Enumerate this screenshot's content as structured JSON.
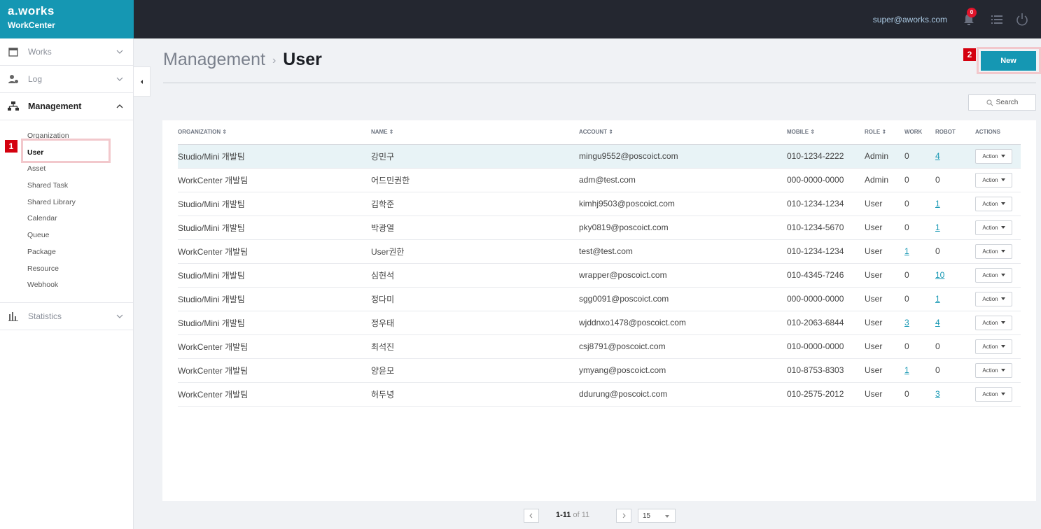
{
  "brand": {
    "logo": "a.works",
    "sub": "WorkCenter"
  },
  "header": {
    "user_email": "super@aworks.com",
    "notification_count": "0"
  },
  "sidebar": {
    "items": [
      {
        "label": "Works",
        "icon": "calendar-icon",
        "expanded": false
      },
      {
        "label": "Log",
        "icon": "user-log-icon",
        "expanded": false
      },
      {
        "label": "Management",
        "icon": "org-chart-icon",
        "expanded": true
      },
      {
        "label": "Statistics",
        "icon": "bar-chart-icon",
        "expanded": false
      }
    ],
    "management_sub": [
      "Organization",
      "User",
      "Asset",
      "Shared Task",
      "Shared Library",
      "Calendar",
      "Queue",
      "Package",
      "Resource",
      "Webhook"
    ],
    "active_sub": "User"
  },
  "annotations": {
    "n1": "1",
    "n2": "2"
  },
  "page": {
    "breadcrumb_parent": "Management",
    "breadcrumb_sep": "›",
    "title": "User",
    "new_label": "New",
    "search_label": "Search"
  },
  "table": {
    "headers": [
      "ORGANIZATION ⇕",
      "NAME ⇕",
      "ACCOUNT ⇕",
      "MOBILE ⇕",
      "ROLE ⇕",
      "WORK",
      "ROBOT",
      "ACTIONS"
    ],
    "action_label": "Action",
    "rows": [
      [
        "Studio/Mini 개발팀",
        "강민구",
        "mingu9552@poscoict.com",
        "010-1234-2222",
        "Admin",
        "0",
        "4"
      ],
      [
        "WorkCenter 개발팀",
        "어드민권한",
        "adm@test.com",
        "000-0000-0000",
        "Admin",
        "0",
        "0"
      ],
      [
        "Studio/Mini 개발팀",
        "김학준",
        "kimhj9503@poscoict.com",
        "010-1234-1234",
        "User",
        "0",
        "1"
      ],
      [
        "Studio/Mini 개발팀",
        "박광열",
        "pky0819@poscoict.com",
        "010-1234-5670",
        "User",
        "0",
        "1"
      ],
      [
        "WorkCenter 개발팀",
        "User권한",
        "test@test.com",
        "010-1234-1234",
        "User",
        "1",
        "0"
      ],
      [
        "Studio/Mini 개발팀",
        "심현석",
        "wrapper@poscoict.com",
        "010-4345-7246",
        "User",
        "0",
        "10"
      ],
      [
        "Studio/Mini 개발팀",
        "정다미",
        "sgg0091@poscoict.com",
        "000-0000-0000",
        "User",
        "0",
        "1"
      ],
      [
        "Studio/Mini 개발팀",
        "정우태",
        "wjddnxo1478@poscoict.com",
        "010-2063-6844",
        "User",
        "3",
        "4"
      ],
      [
        "WorkCenter 개발팀",
        "최석진",
        "csj8791@poscoict.com",
        "010-0000-0000",
        "User",
        "0",
        "0"
      ],
      [
        "WorkCenter 개발팀",
        "양윤모",
        "ymyang@poscoict.com",
        "010-8753-8303",
        "User",
        "1",
        "0"
      ],
      [
        "WorkCenter 개발팀",
        "허두녕",
        "ddurung@poscoict.com",
        "010-2575-2012",
        "User",
        "0",
        "3"
      ]
    ]
  },
  "pagination": {
    "range": "1-11",
    "of_text": "of 11",
    "page_size": "15"
  },
  "colors": {
    "brand": "#1597b3",
    "topbar": "#242730",
    "annotation": "#d4000e"
  }
}
